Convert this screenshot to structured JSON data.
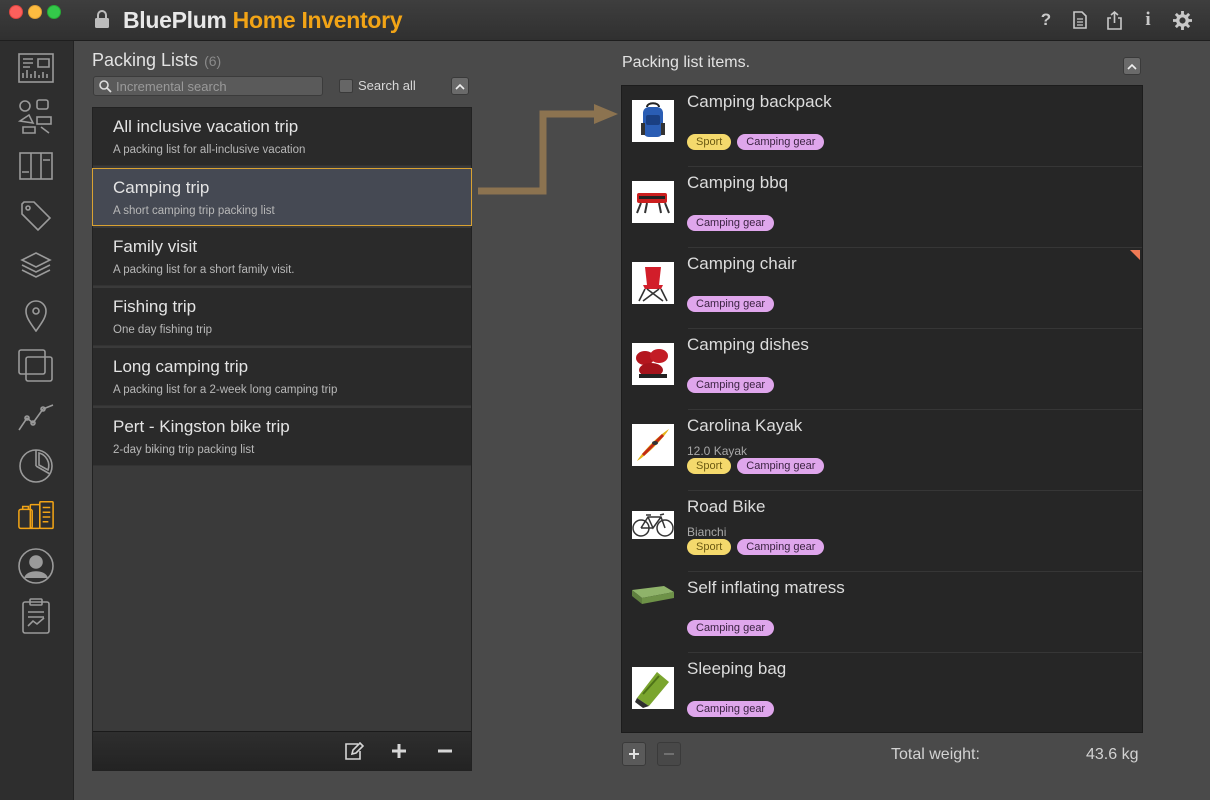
{
  "window": {
    "brand": "BluePlum",
    "product": "Home Inventory"
  },
  "toolbar_icons": [
    "help-icon",
    "document-icon",
    "share-icon",
    "info-icon",
    "gear-icon"
  ],
  "sidebar_icons": [
    "dashboard-icon",
    "categories-icon",
    "books-icon",
    "tag-icon",
    "layers-icon",
    "location-icon",
    "collections-icon",
    "chart-icon",
    "pie-chart-icon",
    "packing-lists-icon",
    "contacts-icon",
    "reports-icon"
  ],
  "sidebar_active": "packing-lists-icon",
  "packing_lists": {
    "title": "Packing Lists",
    "count": "(6)",
    "search_placeholder": "Incremental search",
    "search_all_label": "Search all",
    "items": [
      {
        "name": "All inclusive vacation trip",
        "desc": "A packing list for all-inclusive vacation"
      },
      {
        "name": "Camping trip",
        "desc": "A short camping trip packing list"
      },
      {
        "name": "Family visit",
        "desc": "A packing list for a short family visit."
      },
      {
        "name": "Fishing trip",
        "desc": "One day fishing trip"
      },
      {
        "name": "Long camping trip",
        "desc": "A packing list for a 2-week long camping trip"
      },
      {
        "name": "Pert - Kingston bike trip",
        "desc": "2-day biking trip packing list"
      }
    ],
    "selected": "Camping trip"
  },
  "items_panel": {
    "title": "Packing list items.",
    "items": [
      {
        "name": "Camping backpack",
        "sub": "",
        "tags": [
          "Sport",
          "Camping gear"
        ],
        "thumb": "backpack"
      },
      {
        "name": "Camping bbq",
        "sub": "",
        "tags": [
          "Camping gear"
        ],
        "thumb": "bbq"
      },
      {
        "name": "Camping chair",
        "sub": "",
        "tags": [
          "Camping gear"
        ],
        "thumb": "chair"
      },
      {
        "name": "Camping dishes",
        "sub": "",
        "tags": [
          "Camping gear"
        ],
        "thumb": "dishes"
      },
      {
        "name": "Carolina Kayak",
        "sub": "12.0 Kayak",
        "tags": [
          "Sport",
          "Camping gear"
        ],
        "thumb": "kayak"
      },
      {
        "name": "Road Bike",
        "sub": "Bianchi",
        "tags": [
          "Sport",
          "Camping gear"
        ],
        "thumb": "bike"
      },
      {
        "name": "Self inflating matress",
        "sub": "",
        "tags": [
          "Camping gear"
        ],
        "thumb": "mattress"
      },
      {
        "name": "Sleeping bag",
        "sub": "",
        "tags": [
          "Camping gear"
        ],
        "thumb": "sleepingbag"
      }
    ],
    "total_weight_label": "Total weight:",
    "total_weight_value": "43.6 kg"
  },
  "colors": {
    "accent": "#f2a416",
    "sport_tag": "#f4d96c",
    "camping_tag": "#dfa6ec",
    "selection_border": "#d9a232"
  }
}
